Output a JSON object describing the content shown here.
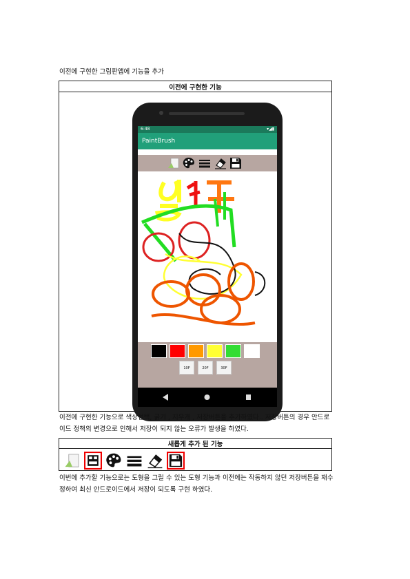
{
  "intro": "이전에 구현한 그림판앱에 기능을 추가",
  "section1": {
    "header": "이전에 구현한 기능",
    "phone": {
      "time": "6:48",
      "app_title": "PaintBrush",
      "tools": [
        "eraser-board-icon",
        "palette-icon",
        "stroke-width-icon",
        "eraser-icon",
        "save-icon"
      ],
      "swatch_colors": [
        "#000000",
        "#ff0000",
        "#ff9900",
        "#ffff33",
        "#33dd33",
        "#ffffff"
      ],
      "size_buttons": [
        "10F",
        "20F",
        "30F"
      ]
    }
  },
  "desc1": "이전에 구현한 기능으로 색상선택, 굵기 , 지우개 , 저장버튼을 추가하였다.. 저장버튼의 경우 안드로이드 정책의 변경으로 인해서 저장이 되지 않는 오류가 발생을 하였다.",
  "section2": {
    "header": "새롭게 추가 된 기능",
    "tools": [
      "eraser-board-icon",
      "shape-icon",
      "palette-icon",
      "stroke-width-icon",
      "eraser-icon",
      "save-icon"
    ]
  },
  "desc2": " 이번에 추가할 기능으로는 도형을 그릴 수 있는 도형 기능과 이전에는 작동하지 않던 저장버튼을 재수정하여 최신 안드로이드에서 저장이 되도록 구현 하였다."
}
